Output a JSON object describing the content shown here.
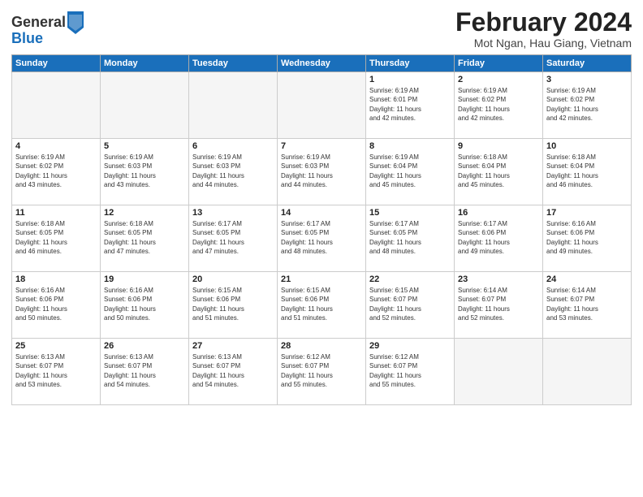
{
  "header": {
    "logo_general": "General",
    "logo_blue": "Blue",
    "main_title": "February 2024",
    "subtitle": "Mot Ngan, Hau Giang, Vietnam"
  },
  "weekdays": [
    "Sunday",
    "Monday",
    "Tuesday",
    "Wednesday",
    "Thursday",
    "Friday",
    "Saturday"
  ],
  "weeks": [
    [
      {
        "day": "",
        "info": ""
      },
      {
        "day": "",
        "info": ""
      },
      {
        "day": "",
        "info": ""
      },
      {
        "day": "",
        "info": ""
      },
      {
        "day": "1",
        "info": "Sunrise: 6:19 AM\nSunset: 6:01 PM\nDaylight: 11 hours\nand 42 minutes."
      },
      {
        "day": "2",
        "info": "Sunrise: 6:19 AM\nSunset: 6:02 PM\nDaylight: 11 hours\nand 42 minutes."
      },
      {
        "day": "3",
        "info": "Sunrise: 6:19 AM\nSunset: 6:02 PM\nDaylight: 11 hours\nand 42 minutes."
      }
    ],
    [
      {
        "day": "4",
        "info": "Sunrise: 6:19 AM\nSunset: 6:02 PM\nDaylight: 11 hours\nand 43 minutes."
      },
      {
        "day": "5",
        "info": "Sunrise: 6:19 AM\nSunset: 6:03 PM\nDaylight: 11 hours\nand 43 minutes."
      },
      {
        "day": "6",
        "info": "Sunrise: 6:19 AM\nSunset: 6:03 PM\nDaylight: 11 hours\nand 44 minutes."
      },
      {
        "day": "7",
        "info": "Sunrise: 6:19 AM\nSunset: 6:03 PM\nDaylight: 11 hours\nand 44 minutes."
      },
      {
        "day": "8",
        "info": "Sunrise: 6:19 AM\nSunset: 6:04 PM\nDaylight: 11 hours\nand 45 minutes."
      },
      {
        "day": "9",
        "info": "Sunrise: 6:18 AM\nSunset: 6:04 PM\nDaylight: 11 hours\nand 45 minutes."
      },
      {
        "day": "10",
        "info": "Sunrise: 6:18 AM\nSunset: 6:04 PM\nDaylight: 11 hours\nand 46 minutes."
      }
    ],
    [
      {
        "day": "11",
        "info": "Sunrise: 6:18 AM\nSunset: 6:05 PM\nDaylight: 11 hours\nand 46 minutes."
      },
      {
        "day": "12",
        "info": "Sunrise: 6:18 AM\nSunset: 6:05 PM\nDaylight: 11 hours\nand 47 minutes."
      },
      {
        "day": "13",
        "info": "Sunrise: 6:17 AM\nSunset: 6:05 PM\nDaylight: 11 hours\nand 47 minutes."
      },
      {
        "day": "14",
        "info": "Sunrise: 6:17 AM\nSunset: 6:05 PM\nDaylight: 11 hours\nand 48 minutes."
      },
      {
        "day": "15",
        "info": "Sunrise: 6:17 AM\nSunset: 6:05 PM\nDaylight: 11 hours\nand 48 minutes."
      },
      {
        "day": "16",
        "info": "Sunrise: 6:17 AM\nSunset: 6:06 PM\nDaylight: 11 hours\nand 49 minutes."
      },
      {
        "day": "17",
        "info": "Sunrise: 6:16 AM\nSunset: 6:06 PM\nDaylight: 11 hours\nand 49 minutes."
      }
    ],
    [
      {
        "day": "18",
        "info": "Sunrise: 6:16 AM\nSunset: 6:06 PM\nDaylight: 11 hours\nand 50 minutes."
      },
      {
        "day": "19",
        "info": "Sunrise: 6:16 AM\nSunset: 6:06 PM\nDaylight: 11 hours\nand 50 minutes."
      },
      {
        "day": "20",
        "info": "Sunrise: 6:15 AM\nSunset: 6:06 PM\nDaylight: 11 hours\nand 51 minutes."
      },
      {
        "day": "21",
        "info": "Sunrise: 6:15 AM\nSunset: 6:06 PM\nDaylight: 11 hours\nand 51 minutes."
      },
      {
        "day": "22",
        "info": "Sunrise: 6:15 AM\nSunset: 6:07 PM\nDaylight: 11 hours\nand 52 minutes."
      },
      {
        "day": "23",
        "info": "Sunrise: 6:14 AM\nSunset: 6:07 PM\nDaylight: 11 hours\nand 52 minutes."
      },
      {
        "day": "24",
        "info": "Sunrise: 6:14 AM\nSunset: 6:07 PM\nDaylight: 11 hours\nand 53 minutes."
      }
    ],
    [
      {
        "day": "25",
        "info": "Sunrise: 6:13 AM\nSunset: 6:07 PM\nDaylight: 11 hours\nand 53 minutes."
      },
      {
        "day": "26",
        "info": "Sunrise: 6:13 AM\nSunset: 6:07 PM\nDaylight: 11 hours\nand 54 minutes."
      },
      {
        "day": "27",
        "info": "Sunrise: 6:13 AM\nSunset: 6:07 PM\nDaylight: 11 hours\nand 54 minutes."
      },
      {
        "day": "28",
        "info": "Sunrise: 6:12 AM\nSunset: 6:07 PM\nDaylight: 11 hours\nand 55 minutes."
      },
      {
        "day": "29",
        "info": "Sunrise: 6:12 AM\nSunset: 6:07 PM\nDaylight: 11 hours\nand 55 minutes."
      },
      {
        "day": "",
        "info": ""
      },
      {
        "day": "",
        "info": ""
      }
    ]
  ]
}
